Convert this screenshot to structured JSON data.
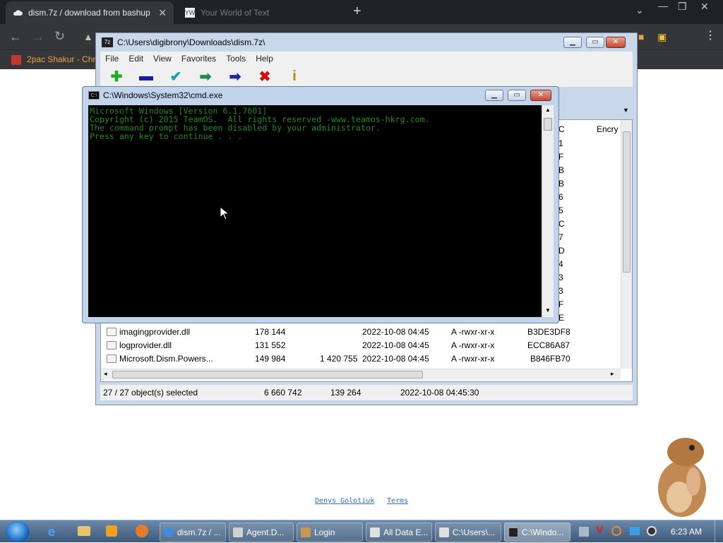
{
  "chrome": {
    "tabs": [
      {
        "title": "dism.7z / download from bashup",
        "active": true
      },
      {
        "title": "Your World of Text",
        "active": false
      }
    ],
    "bookmark": "2pac Shakur - Chro",
    "new_tab": "+",
    "close_glyph": "✕"
  },
  "page": {
    "links": [
      "Denys Golotiuk",
      "Terms"
    ]
  },
  "sevenzip": {
    "title": "C:\\Users\\digibrony\\Downloads\\dism.7z\\",
    "app_badge": "7z",
    "menu": [
      "File",
      "Edit",
      "View",
      "Favorites",
      "Tools",
      "Help"
    ],
    "column_headers": [
      "C",
      "Encry"
    ],
    "col_chars": [
      "1",
      "F",
      "B",
      "B",
      "6",
      "5",
      "C",
      "7",
      "D",
      "4",
      "3",
      "3",
      "F",
      "E"
    ],
    "rows": [
      {
        "name": "imagingprovider.dll",
        "size": "178 144",
        "packed": "",
        "modified": "2022-10-08 04:45",
        "attr": "A -rwxr-xr-x",
        "crc": "B3DE3DF8"
      },
      {
        "name": "logprovider.dll",
        "size": "131 552",
        "packed": "",
        "modified": "2022-10-08 04:45",
        "attr": "A -rwxr-xr-x",
        "crc": "ECC86A87"
      },
      {
        "name": "Microsoft.Dism.Powers...",
        "size": "149 984",
        "packed": "1 420 755",
        "modified": "2022-10-08 04:45",
        "attr": "A -rwxr-xr-x",
        "crc": "B846FB70"
      }
    ],
    "status": {
      "selected": "27 / 27 object(s) selected",
      "size": "6 660 742",
      "packed": "139 264",
      "modified": "2022-10-08 04:45:30"
    }
  },
  "cmd": {
    "title": "C:\\Windows\\System32\\cmd.exe",
    "badge": "C:\\",
    "lines": [
      "Microsoft Windows [Version 6.1.7601]",
      "Copyright (c) 2015 TeamOS.  All rights reserved -www.teamos-hkrg.com.",
      "",
      "The command prompt has been disabled by your administrator.",
      "",
      "Press any key to continue . . ."
    ]
  },
  "taskbar": {
    "items": [
      {
        "label": "dism.7z / ...",
        "color": "#3f8be0"
      },
      {
        "label": "Agent.D...",
        "color": "#d0d0d0"
      },
      {
        "label": "Login",
        "color": "#c79a54"
      },
      {
        "label": "All Data E...",
        "color": "#e0e0e0"
      },
      {
        "label": "C:\\Users\\...",
        "color": "#e0e0e0"
      },
      {
        "label": "C:\\Windo...",
        "color": "#222222"
      }
    ],
    "clock": "6:23 AM"
  },
  "colors": {
    "console_text": "#1c8a1c",
    "chrome_dark": "#202124",
    "taskbar": "#4a6a8c"
  }
}
